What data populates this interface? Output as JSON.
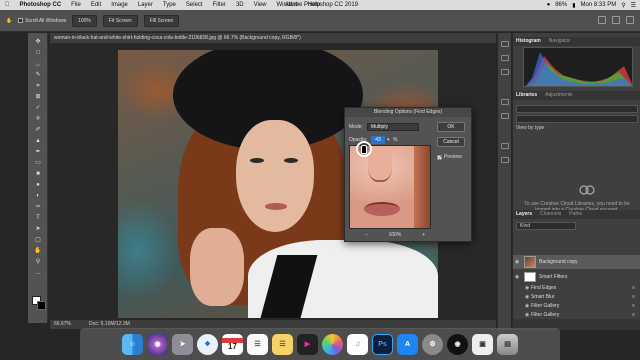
{
  "menubar": {
    "apple": "",
    "app_name": "Photoshop CC",
    "items": [
      "File",
      "Edit",
      "Image",
      "Layer",
      "Type",
      "Select",
      "Filter",
      "3D",
      "View",
      "Window",
      "Help"
    ],
    "window_title": "Adobe Photoshop CC 2019",
    "battery": "86%",
    "clock": "Mon 8:33 PM"
  },
  "options_bar": {
    "scroll_all_windows": "Scroll All Windows",
    "zoom": "100%",
    "fit_screen": "Fit Screen",
    "fill_screen": "Fill Screen"
  },
  "document": {
    "tab_title": "woman-in-black-hat-and-white-shirt-holding-coca-cola-bottle-2106828.jpg @ 66.7% (Background copy, RGB/8*)",
    "zoom_status": "66.67%",
    "doc_size": "Doc: 6.16M/12.3M"
  },
  "panels": {
    "histogram_tab": "Histogram",
    "navigator_tab": "Navigator",
    "libraries_tab": "Libraries",
    "adjustments_tab": "Adjustments",
    "view_by": "View by type",
    "lib_message": "To use Creative Cloud Libraries, you need to be logged into a Creative Cloud account.",
    "layers_tab": "Layers",
    "channels_tab": "Channels",
    "paths_tab": "Paths",
    "kind_label": "Kind",
    "layers": [
      {
        "name": "Background copy"
      },
      {
        "name": "Smart Filters"
      },
      {
        "name": "Find Edges"
      },
      {
        "name": "Smart Blur"
      },
      {
        "name": "Filter Gallery"
      },
      {
        "name": "Filter Gallery"
      }
    ]
  },
  "dialog": {
    "title": "Blending Options (Find Edges)",
    "mode_label": "Mode:",
    "mode_value": "Multiply",
    "opacity_label": "Opacity:",
    "opacity_value": "43",
    "percent": "%",
    "ok": "OK",
    "cancel": "Cancel",
    "preview_label": "Preview",
    "zoom_out": "−",
    "zoom_value": "100%",
    "zoom_in": "+"
  },
  "dock": {
    "apps": [
      "Finder",
      "Siri",
      "Launchpad",
      "Safari",
      "Calendar",
      "Reminders",
      "Notes",
      "Final Cut Pro",
      "Photos",
      "Music",
      "Photoshop",
      "App Store",
      "System Preferences",
      "Screen Recorder",
      "Preview",
      "Trash"
    ],
    "calendar_day": "17",
    "ps_label": "Ps"
  }
}
